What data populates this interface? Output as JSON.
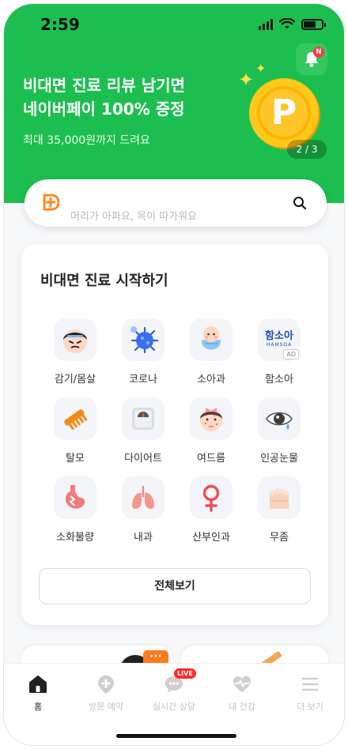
{
  "status": {
    "time": "2:59"
  },
  "notification": {
    "badge": "N"
  },
  "promo": {
    "line1": "비대면 진료 리뷰 남기면",
    "line2": "네이버페이 100% 증정",
    "subtitle": "최대 35,000원까지 드려요",
    "coin_letter": "P",
    "pager": "2 / 3"
  },
  "search": {
    "placeholder": "머리가 아파요, 목이 따가워요"
  },
  "card": {
    "title": "비대면 진료 시작하기",
    "categories": [
      {
        "label": "감기/몸살",
        "icon": "sick-face-icon"
      },
      {
        "label": "코로나",
        "icon": "virus-icon"
      },
      {
        "label": "소아과",
        "icon": "baby-icon"
      },
      {
        "label": "함소아",
        "icon": "hamsoa-logo",
        "logo_text": "함소아",
        "logo_sub": "HAMSOA",
        "ad": "AD"
      },
      {
        "label": "탈모",
        "icon": "comb-icon"
      },
      {
        "label": "다이어트",
        "icon": "scale-icon"
      },
      {
        "label": "여드름",
        "icon": "acne-face-icon"
      },
      {
        "label": "인공눈물",
        "icon": "eye-drop-icon"
      },
      {
        "label": "소화불량",
        "icon": "stomach-icon"
      },
      {
        "label": "내과",
        "icon": "lungs-icon"
      },
      {
        "label": "산부인과",
        "icon": "female-symbol-icon"
      },
      {
        "label": "무좀",
        "icon": "foot-icon"
      }
    ],
    "all_button": "전체보기"
  },
  "tabbar": {
    "items": [
      {
        "label": "홈",
        "icon": "home-icon",
        "active": true
      },
      {
        "label": "방문 예약",
        "icon": "hospital-pin-icon"
      },
      {
        "label": "실시간 상담",
        "icon": "chat-icon",
        "badge": "LIVE"
      },
      {
        "label": "내 건강",
        "icon": "heart-pulse-icon"
      },
      {
        "label": "더 보기",
        "icon": "menu-icon"
      }
    ]
  },
  "colors": {
    "brand_green": "#1cbf4f",
    "live_red": "#ff2b2b",
    "coin_gold": "#f6b800"
  }
}
